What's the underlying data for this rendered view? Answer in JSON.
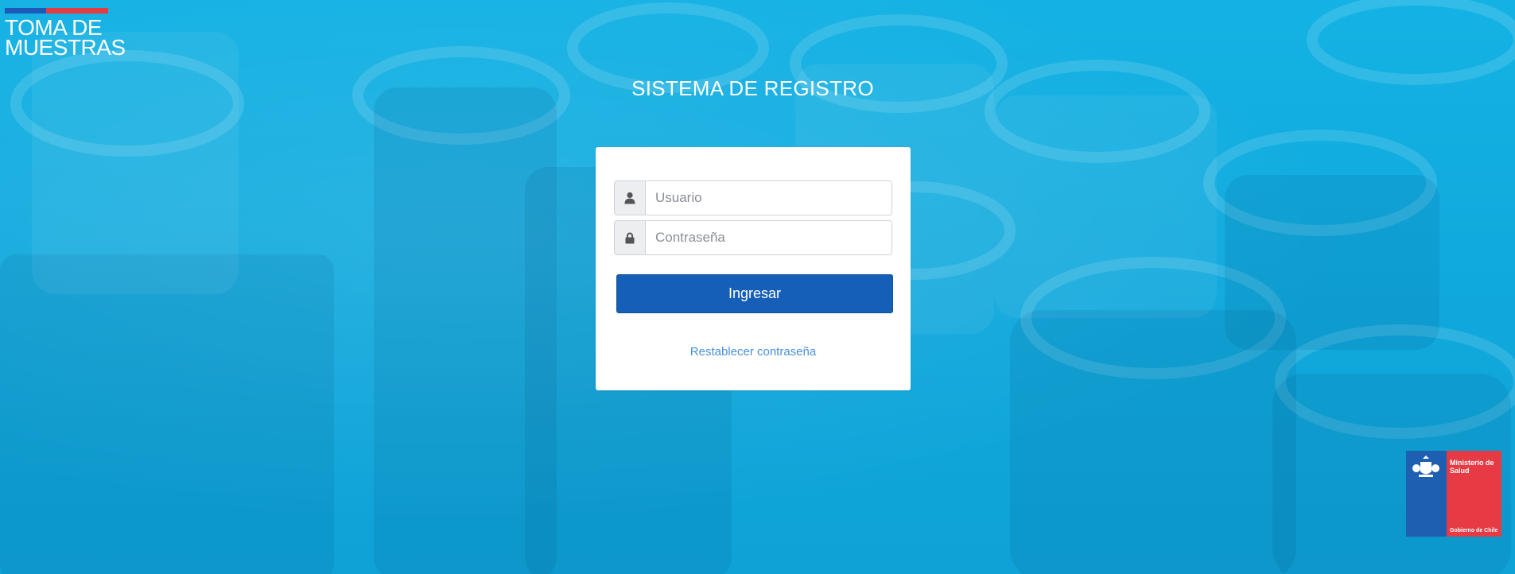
{
  "brand": {
    "line1": "TOMA DE",
    "line2": "MUESTRAS"
  },
  "page_title": "SISTEMA DE REGISTRO",
  "login": {
    "username_placeholder": "Usuario",
    "password_placeholder": "Contraseña",
    "submit_label": "Ingresar",
    "reset_link": "Restablecer contraseña"
  },
  "ministry": {
    "name": "Ministerio de Salud",
    "government": "Gobierno de Chile"
  },
  "colors": {
    "background": "#11aee0",
    "primary_button": "#155fb8",
    "link": "#4a90d9",
    "brand_blue": "#1d59b8",
    "brand_red": "#e63b3f"
  },
  "icons": {
    "username": "user-icon",
    "password": "lock-icon"
  }
}
